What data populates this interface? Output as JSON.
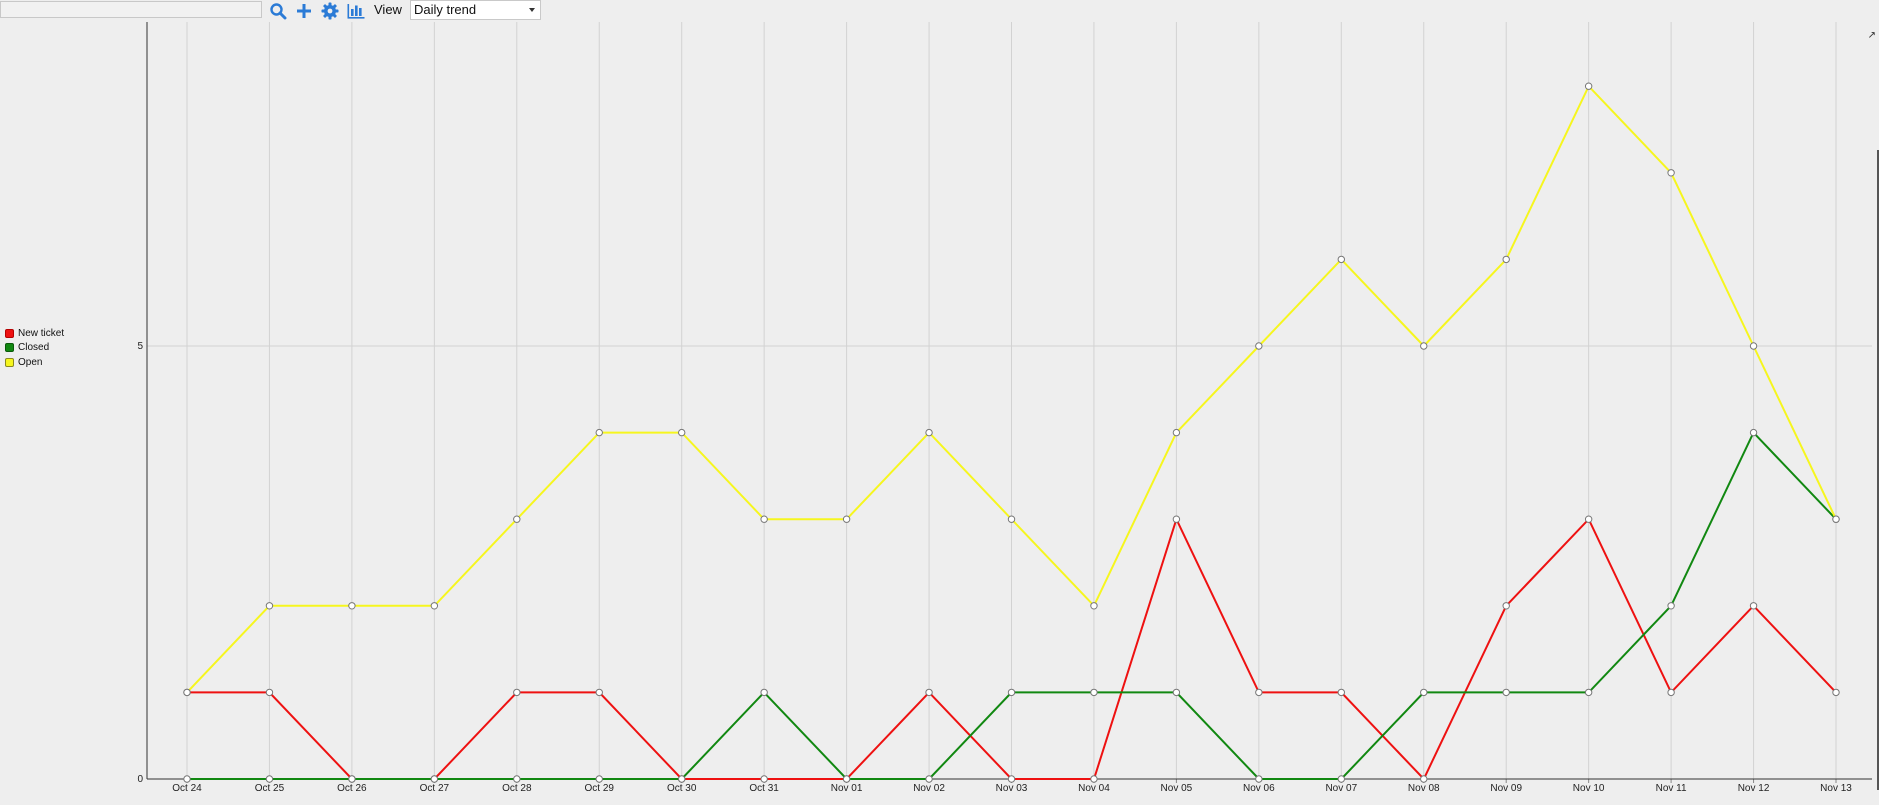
{
  "toolbar": {
    "search_value": "",
    "icons": [
      "search-icon",
      "plus-icon",
      "gear-icon",
      "bar-chart-icon"
    ],
    "view_label": "View",
    "view_selected": "Daily trend"
  },
  "colors": {
    "new_ticket": "#ee1111",
    "closed": "#118811",
    "open": "#f6f61e",
    "accent": "#2b7bd6"
  },
  "chart_data": {
    "type": "line",
    "categories": [
      "Oct 24",
      "Oct 25",
      "Oct 26",
      "Oct 27",
      "Oct 28",
      "Oct 29",
      "Oct 30",
      "Oct 31",
      "Nov 01",
      "Nov 02",
      "Nov 03",
      "Nov 04",
      "Nov 05",
      "Nov 06",
      "Nov 07",
      "Nov 08",
      "Nov 09",
      "Nov 10",
      "Nov 11",
      "Nov 12",
      "Nov 13"
    ],
    "series": [
      {
        "name": "New ticket",
        "color": "#ee1111",
        "values": [
          1,
          1,
          0,
          0,
          1,
          1,
          0,
          0,
          0,
          1,
          0,
          0,
          3,
          1,
          1,
          0,
          2,
          3,
          1,
          2,
          1
        ]
      },
      {
        "name": "Closed",
        "color": "#118811",
        "values": [
          0,
          0,
          0,
          0,
          0,
          0,
          0,
          1,
          0,
          0,
          1,
          1,
          1,
          0,
          0,
          1,
          1,
          1,
          2,
          4,
          3
        ]
      },
      {
        "name": "Open",
        "color": "#f6f61e",
        "values": [
          1,
          2,
          2,
          2,
          3,
          4,
          4,
          3,
          3,
          4,
          3,
          2,
          4,
          5,
          6,
          5,
          6,
          8,
          7,
          5,
          3
        ]
      }
    ],
    "yticks": [
      "0",
      "5"
    ],
    "ylim": [
      0,
      8.75
    ],
    "grid": true,
    "legend_position": "left"
  }
}
